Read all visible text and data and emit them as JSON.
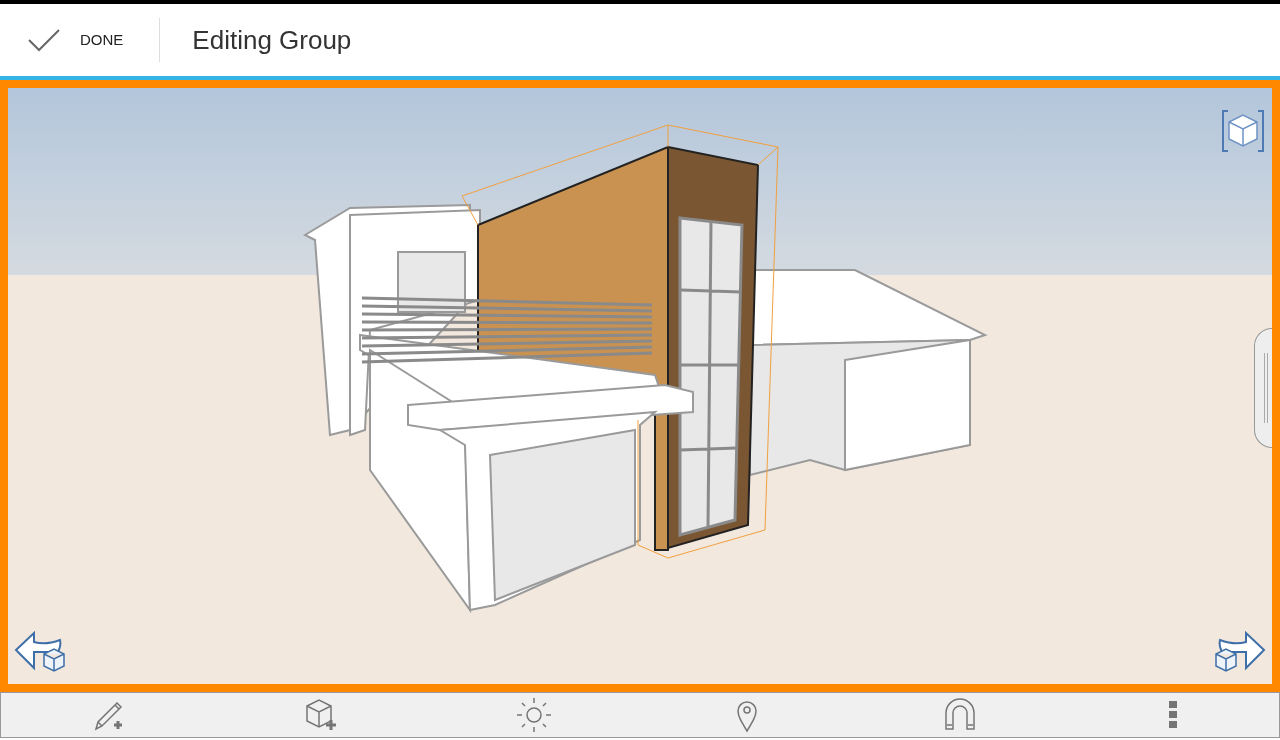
{
  "header": {
    "done_label": "DONE",
    "title": "Editing Group"
  }
}
